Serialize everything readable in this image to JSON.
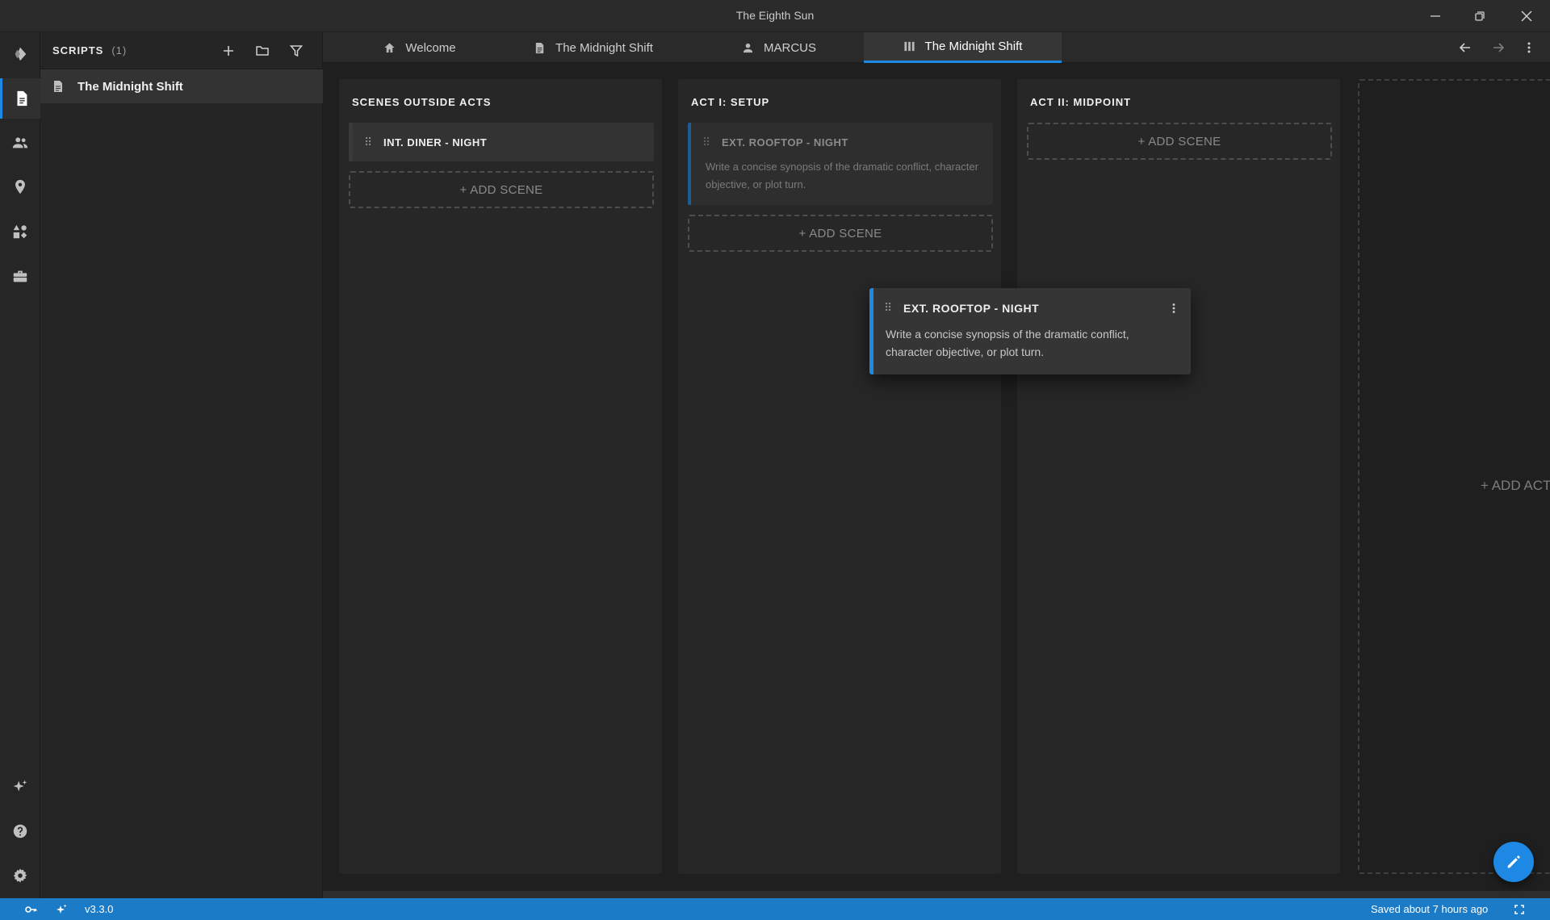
{
  "window": {
    "title": "The Eighth Sun"
  },
  "sidebar": {
    "title": "SCRIPTS",
    "count": "(1)",
    "items": [
      {
        "label": "The Midnight Shift"
      }
    ]
  },
  "tabs": [
    {
      "label": "Welcome",
      "icon": "home-icon"
    },
    {
      "label": "The Midnight Shift",
      "icon": "document-icon"
    },
    {
      "label": "MARCUS",
      "icon": "person-icon"
    },
    {
      "label": "The Midnight Shift",
      "icon": "board-icon",
      "active": true
    }
  ],
  "board": {
    "columns": [
      {
        "title": "SCENES OUTSIDE ACTS",
        "scenes": [
          {
            "title": "INT. DINER - NIGHT"
          }
        ],
        "add_label": "+ ADD SCENE"
      },
      {
        "title": "ACT I: SETUP",
        "scenes": [
          {
            "title": "EXT. ROOFTOP - NIGHT",
            "synopsis": "Write a concise synopsis of the dramatic conflict, character objective, or plot turn."
          }
        ],
        "add_label": "+ ADD SCENE"
      },
      {
        "title": "ACT II: MIDPOINT",
        "scenes": [],
        "add_label": "+ ADD SCENE"
      }
    ],
    "add_act_label": "+ ADD ACT",
    "dragging_card": {
      "title": "EXT. ROOFTOP - NIGHT",
      "synopsis": "Write a concise synopsis of the dramatic conflict, character objective, or plot turn."
    }
  },
  "statusbar": {
    "version": "v3.3.0",
    "saved": "Saved about 7 hours ago"
  },
  "colors": {
    "accent": "#1e88e5",
    "statusbar": "#1b7bc6",
    "background": "#1f1f1f"
  }
}
